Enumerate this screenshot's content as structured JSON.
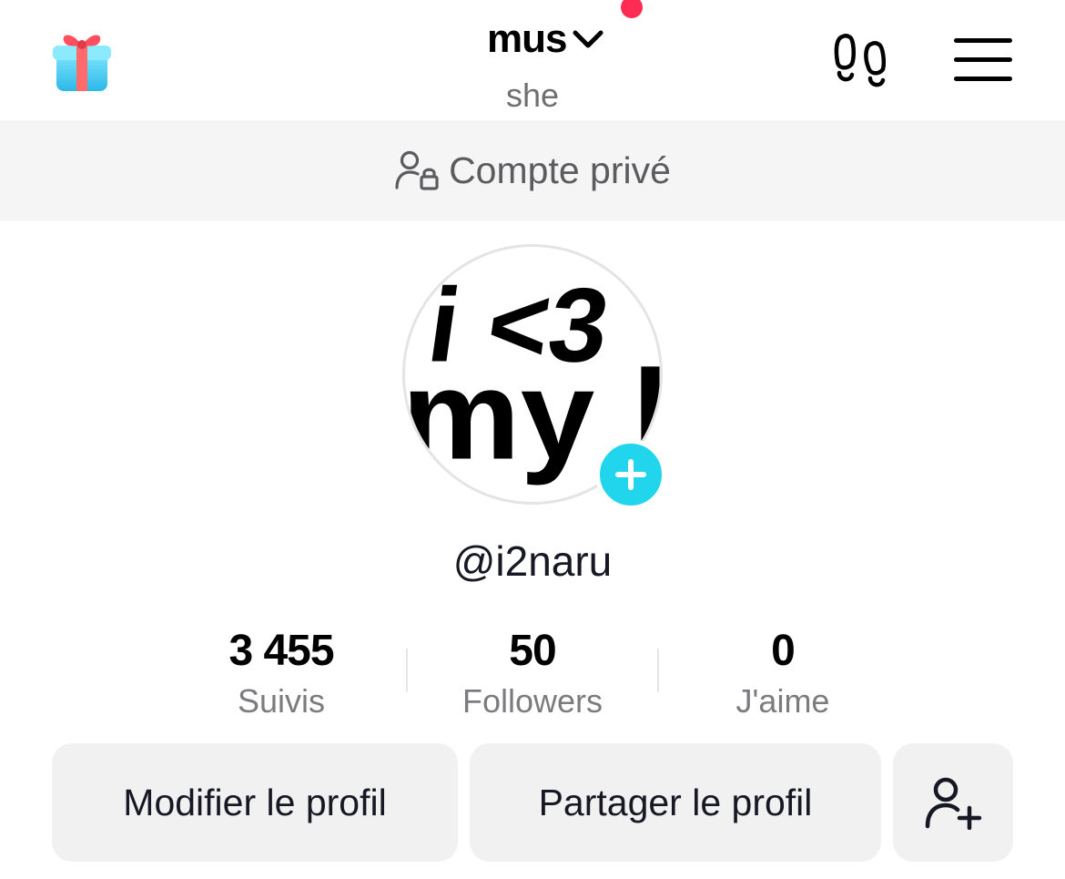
{
  "header": {
    "title": "mus",
    "pronoun": "she",
    "icons": {
      "left": "gift-icon",
      "title_dropdown": "chevron-down-icon",
      "notification": "notification-dot",
      "right_1": "footprints-icon",
      "right_2": "menu-icon"
    },
    "notification_color": "#fe2c55"
  },
  "banner": {
    "text": "Compte privé",
    "icon": "private-account-icon"
  },
  "profile": {
    "avatar_text_line1": "i <3",
    "avatar_text_line2": "my bf",
    "add_icon": "plus-icon",
    "add_badge_color": "#20d5ec",
    "username": "@i2naru"
  },
  "stats": [
    {
      "value": "3 455",
      "label": "Suivis"
    },
    {
      "value": "50",
      "label": "Followers"
    },
    {
      "value": "0",
      "label": "J'aime"
    }
  ],
  "actions": {
    "edit_label": "Modifier le profil",
    "share_label": "Partager le profil",
    "add_friend_icon": "add-user-icon"
  }
}
